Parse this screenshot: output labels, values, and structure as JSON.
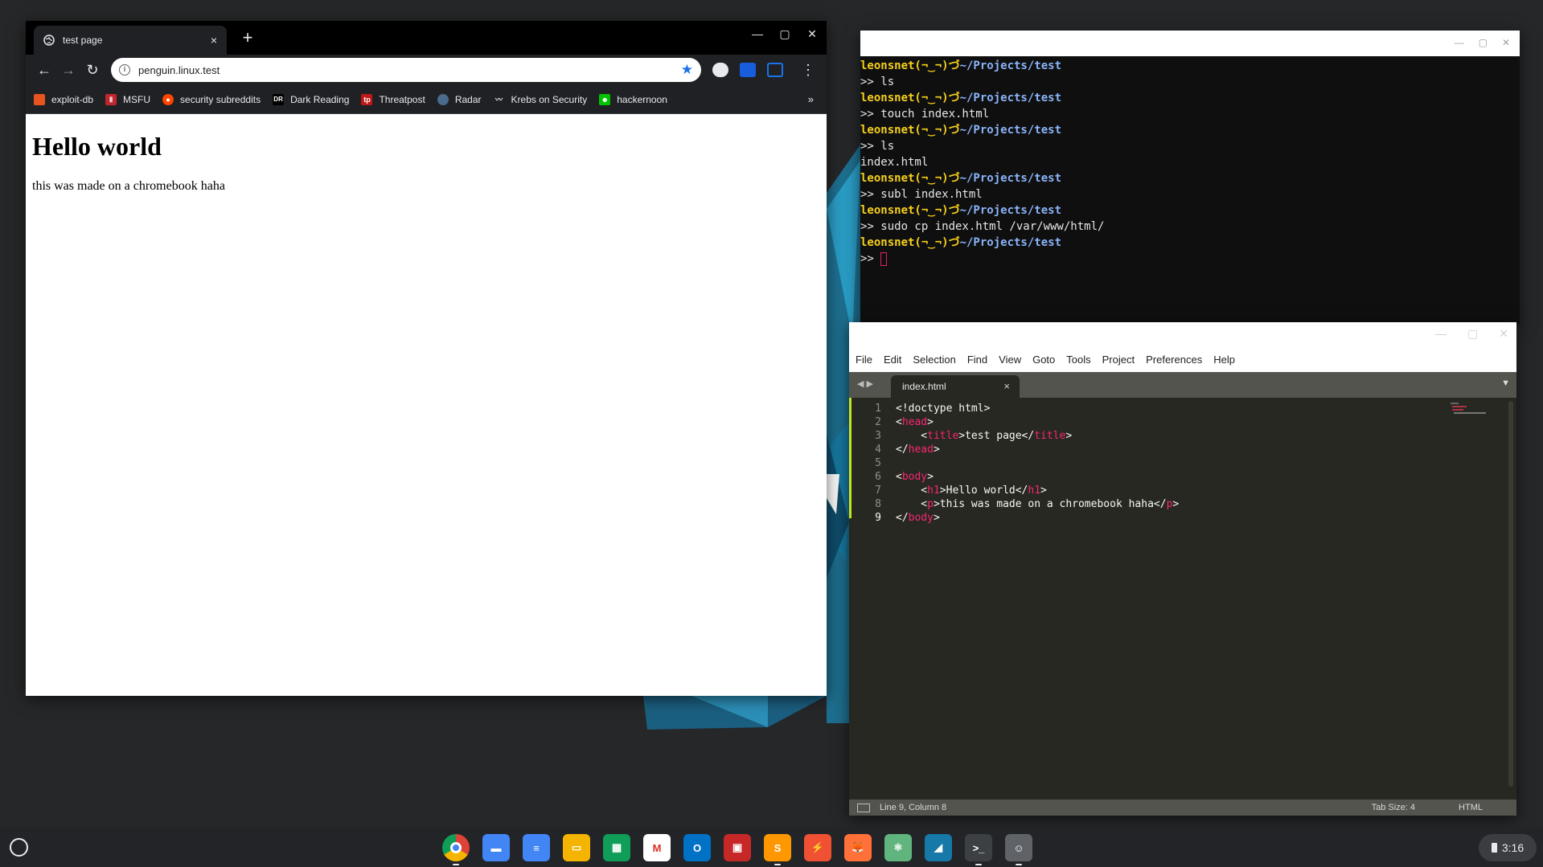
{
  "chrome": {
    "tab_title": "test page",
    "tab_close": "×",
    "new_tab": "+",
    "url": "penguin.linux.test",
    "bookmarks": [
      {
        "label": "exploit-db",
        "color": "#e8531f"
      },
      {
        "label": "MSFU",
        "color": "#c0262d"
      },
      {
        "label": "security subreddits",
        "color": "#ff4500"
      },
      {
        "label": "Dark Reading",
        "color": "#000000",
        "glyph": "DR"
      },
      {
        "label": "Threatpost",
        "color": "#c01818"
      },
      {
        "label": "Radar",
        "color": "#4a6b8c"
      },
      {
        "label": "Krebs on Security",
        "color": "#202124"
      },
      {
        "label": "hackernoon",
        "color": "#00c300"
      }
    ],
    "bookmarks_more": "»",
    "page": {
      "heading": "Hello world",
      "paragraph": "this was made on a chromebook haha"
    }
  },
  "terminal": {
    "user": "leonsnet(¬‿¬)づ",
    "path": "~/Projects/test",
    "lines": [
      {
        "type": "prompt"
      },
      {
        "type": "cmd",
        "text": ">> ls"
      },
      {
        "type": "prompt"
      },
      {
        "type": "cmd",
        "text": ">> touch index.html"
      },
      {
        "type": "prompt"
      },
      {
        "type": "cmd",
        "text": ">> ls"
      },
      {
        "type": "out",
        "text": "index.html"
      },
      {
        "type": "prompt"
      },
      {
        "type": "cmd",
        "text": ">> subl index.html"
      },
      {
        "type": "prompt"
      },
      {
        "type": "cmd",
        "text": ">> sudo cp index.html /var/www/html/"
      },
      {
        "type": "prompt"
      },
      {
        "type": "cursor",
        "text": ">> "
      }
    ]
  },
  "sublime": {
    "menu": [
      "File",
      "Edit",
      "Selection",
      "Find",
      "View",
      "Goto",
      "Tools",
      "Project",
      "Preferences",
      "Help"
    ],
    "tab_title": "index.html",
    "tab_close": "×",
    "line_numbers": [
      "1",
      "2",
      "3",
      "4",
      "5",
      "6",
      "7",
      "8",
      "9"
    ],
    "current_line": "9",
    "status_position": "Line 9, Column 8",
    "status_tab_size": "Tab Size: 4",
    "status_syntax": "HTML"
  },
  "shelf": {
    "apps": [
      {
        "name": "chrome-app",
        "bg": "#ffffff",
        "glyph": "",
        "active": true
      },
      {
        "name": "files-app",
        "bg": "#4285f4",
        "glyph": "▬",
        "active": false
      },
      {
        "name": "docs-app",
        "bg": "#4285f4",
        "glyph": "≡",
        "active": false
      },
      {
        "name": "slides-app",
        "bg": "#f4b400",
        "glyph": "▭",
        "active": false
      },
      {
        "name": "sheets-app",
        "bg": "#0f9d58",
        "glyph": "▦",
        "active": false
      },
      {
        "name": "gmail-app",
        "bg": "#ffffff",
        "glyph": "M",
        "active": false
      },
      {
        "name": "outlook-app",
        "bg": "#0072c6",
        "glyph": "O",
        "active": false
      },
      {
        "name": "gallery-app",
        "bg": "#c62828",
        "glyph": "▣",
        "active": false
      },
      {
        "name": "sublime-app",
        "bg": "#ff9800",
        "glyph": "S",
        "active": true
      },
      {
        "name": "git-app",
        "bg": "#f05133",
        "glyph": "⚡",
        "active": false
      },
      {
        "name": "firefox-app",
        "bg": "#ff7139",
        "glyph": "🦊",
        "active": false
      },
      {
        "name": "atom-app",
        "bg": "#5fb57d",
        "glyph": "⚛",
        "active": false
      },
      {
        "name": "wireshark-app",
        "bg": "#1679a7",
        "glyph": "◢",
        "active": false
      },
      {
        "name": "terminal-app",
        "bg": "#3c4043",
        "glyph": ">_",
        "active": true
      },
      {
        "name": "penguin-app",
        "bg": "#5f6368",
        "glyph": "☺",
        "active": true
      }
    ],
    "time": "3:16"
  }
}
